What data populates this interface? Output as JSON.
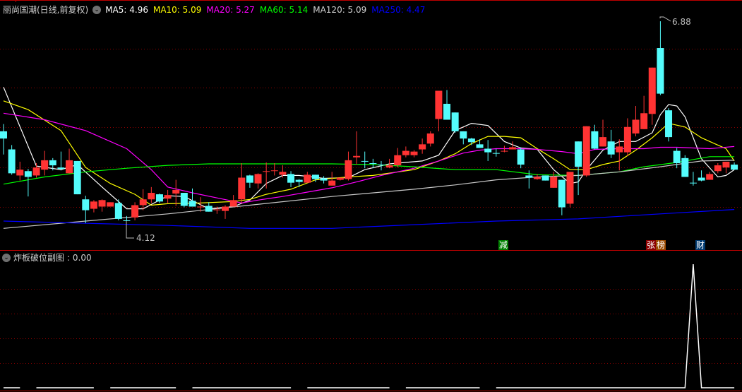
{
  "header": {
    "title": "丽尚国潮(日线,前复权)",
    "ma": [
      {
        "label": "MA5: 4.96",
        "color": "#ffffff"
      },
      {
        "label": "MA10: 5.09",
        "color": "#ffff00"
      },
      {
        "label": "MA20: 5.27",
        "color": "#ff00ff"
      },
      {
        "label": "MA60: 5.14",
        "color": "#00ff00"
      },
      {
        "label": "MA120: 5.09",
        "color": "#d0d0d0"
      },
      {
        "label": "MA250: 4.47",
        "color": "#0000ff"
      }
    ]
  },
  "annotations": {
    "high": "6.88",
    "low": "4.12"
  },
  "event_tags": [
    {
      "label": "减",
      "color": "#008000"
    },
    {
      "label": "张",
      "color": "#8b0000"
    },
    {
      "label": "榜",
      "color": "#9a4a00"
    },
    {
      "label": "财",
      "color": "#003a70"
    }
  ],
  "sub_panel": {
    "title": "炸板破位副图",
    "value": ": 0.00"
  },
  "colors": {
    "up": "#ff3333",
    "down": "#54fcfc",
    "grid": "#8b0000",
    "frame": "#c00000"
  },
  "chart_data": {
    "type": "candlestick",
    "ohlc": [
      [
        5.36,
        5.46,
        5.04,
        5.26
      ],
      [
        5.11,
        5.17,
        4.76,
        4.78
      ],
      [
        4.75,
        4.94,
        4.68,
        4.83
      ],
      [
        4.81,
        4.84,
        4.46,
        4.73
      ],
      [
        4.75,
        4.92,
        4.72,
        4.86
      ],
      [
        4.83,
        5.09,
        4.75,
        4.96
      ],
      [
        4.96,
        4.99,
        4.82,
        4.89
      ],
      [
        4.86,
        5.08,
        4.82,
        4.84
      ],
      [
        4.78,
        5.12,
        4.78,
        4.96
      ],
      [
        4.95,
        4.95,
        4.49,
        4.49
      ],
      [
        4.42,
        4.47,
        4.09,
        4.27
      ],
      [
        4.29,
        4.41,
        4.24,
        4.39
      ],
      [
        4.32,
        4.42,
        4.25,
        4.41
      ],
      [
        4.32,
        4.38,
        4.32,
        4.38
      ],
      [
        4.37,
        4.42,
        4.13,
        4.15
      ],
      [
        4.13,
        4.19,
        4.12,
        4.13
      ],
      [
        4.17,
        4.38,
        4.13,
        4.34
      ],
      [
        4.34,
        4.56,
        4.27,
        4.42
      ],
      [
        4.42,
        4.59,
        4.37,
        4.51
      ],
      [
        4.49,
        4.5,
        4.37,
        4.39
      ],
      [
        4.43,
        4.55,
        4.37,
        4.48
      ],
      [
        4.5,
        4.69,
        4.33,
        4.55
      ],
      [
        4.51,
        4.51,
        4.31,
        4.33
      ],
      [
        4.4,
        4.57,
        4.32,
        4.32
      ],
      [
        4.31,
        4.45,
        4.25,
        4.32
      ],
      [
        4.33,
        4.38,
        4.25,
        4.25
      ],
      [
        4.28,
        4.32,
        4.22,
        4.28
      ],
      [
        4.26,
        4.34,
        4.15,
        4.32
      ],
      [
        4.32,
        4.48,
        4.32,
        4.41
      ],
      [
        4.42,
        4.92,
        4.37,
        4.72
      ],
      [
        4.75,
        4.76,
        4.58,
        4.65
      ],
      [
        4.64,
        4.78,
        4.57,
        4.77
      ],
      [
        4.81,
        4.93,
        4.57,
        4.81
      ],
      [
        4.82,
        4.92,
        4.75,
        4.82
      ],
      [
        4.76,
        4.89,
        4.72,
        4.8
      ],
      [
        4.77,
        4.81,
        4.59,
        4.65
      ],
      [
        4.69,
        4.7,
        4.59,
        4.66
      ],
      [
        4.65,
        4.8,
        4.65,
        4.76
      ],
      [
        4.76,
        4.76,
        4.66,
        4.7
      ],
      [
        4.71,
        4.74,
        4.64,
        4.68
      ],
      [
        4.61,
        4.8,
        4.61,
        4.68
      ],
      [
        4.69,
        4.72,
        4.68,
        4.72
      ],
      [
        4.7,
        5.08,
        4.68,
        4.96
      ],
      [
        5.0,
        5.36,
        4.9,
        5.02
      ],
      [
        4.95,
        5.08,
        4.85,
        4.95
      ],
      [
        4.92,
        4.98,
        4.85,
        4.92
      ],
      [
        4.9,
        4.95,
        4.82,
        4.9
      ],
      [
        4.86,
        4.98,
        4.85,
        4.89
      ],
      [
        4.89,
        5.13,
        4.86,
        5.03
      ],
      [
        5.03,
        5.15,
        5.0,
        5.09
      ],
      [
        5.03,
        5.1,
        5.0,
        5.08
      ],
      [
        5.11,
        5.26,
        5.05,
        5.18
      ],
      [
        5.19,
        5.36,
        5.15,
        5.33
      ],
      [
        5.53,
        5.92,
        5.36,
        5.92
      ],
      [
        5.74,
        5.93,
        5.52,
        5.52
      ],
      [
        5.62,
        5.62,
        5.34,
        5.36
      ],
      [
        5.36,
        5.36,
        5.18,
        5.26
      ],
      [
        5.26,
        5.27,
        5.17,
        5.21
      ],
      [
        5.18,
        5.25,
        5.13,
        5.13
      ],
      [
        5.12,
        5.24,
        4.95,
        5.07
      ],
      [
        5.06,
        5.12,
        5.01,
        5.06
      ],
      [
        5.09,
        5.16,
        5.07,
        5.09
      ],
      [
        5.11,
        5.22,
        5.11,
        5.14
      ],
      [
        5.11,
        5.14,
        4.85,
        4.9
      ],
      [
        4.75,
        4.82,
        4.57,
        4.72
      ],
      [
        4.7,
        4.77,
        4.69,
        4.73
      ],
      [
        4.75,
        4.75,
        4.68,
        4.68
      ],
      [
        4.58,
        4.8,
        4.58,
        4.73
      ],
      [
        4.69,
        4.69,
        4.2,
        4.31
      ],
      [
        4.36,
        4.8,
        4.31,
        4.8
      ],
      [
        5.22,
        5.22,
        4.48,
        4.87
      ],
      [
        4.75,
        5.43,
        4.73,
        5.43
      ],
      [
        5.36,
        5.45,
        5.11,
        5.12
      ],
      [
        5.15,
        5.52,
        5.15,
        5.28
      ],
      [
        5.22,
        5.38,
        4.99,
        5.04
      ],
      [
        5.07,
        5.25,
        4.82,
        5.15
      ],
      [
        5.07,
        5.54,
        5.02,
        5.42
      ],
      [
        5.33,
        5.71,
        5.29,
        5.52
      ],
      [
        5.39,
        5.85,
        5.39,
        5.61
      ],
      [
        5.6,
        6.24,
        5.45,
        6.24
      ],
      [
        6.51,
        6.88,
        5.86,
        5.88
      ],
      [
        5.65,
        5.68,
        5.22,
        5.28
      ],
      [
        5.09,
        5.13,
        4.85,
        4.92
      ],
      [
        4.99,
        5.03,
        4.73,
        4.73
      ],
      [
        4.65,
        4.8,
        4.61,
        4.65
      ],
      [
        4.72,
        4.82,
        4.67,
        4.68
      ],
      [
        4.69,
        4.8,
        4.69,
        4.77
      ],
      [
        4.81,
        4.92,
        4.78,
        4.89
      ],
      [
        4.86,
        4.94,
        4.78,
        4.94
      ],
      [
        4.9,
        4.93,
        4.83,
        4.83
      ]
    ],
    "ma_series": [
      {
        "name": "MA5",
        "color": "#ffffff",
        "points": [
          [
            0,
            5.97
          ],
          [
            4,
            4.88
          ],
          [
            7,
            4.83
          ],
          [
            9,
            4.9
          ],
          [
            12,
            4.59
          ],
          [
            15,
            4.29
          ],
          [
            17,
            4.29
          ],
          [
            20,
            4.47
          ],
          [
            22,
            4.46
          ],
          [
            25,
            4.29
          ],
          [
            28,
            4.32
          ],
          [
            30,
            4.41
          ],
          [
            32,
            4.64
          ],
          [
            34,
            4.75
          ],
          [
            36,
            4.75
          ],
          [
            39,
            4.71
          ],
          [
            42,
            4.72
          ],
          [
            44,
            4.83
          ],
          [
            47,
            4.91
          ],
          [
            51,
            4.95
          ],
          [
            53,
            5.03
          ],
          [
            55,
            5.37
          ],
          [
            57,
            5.47
          ],
          [
            59,
            5.44
          ],
          [
            61,
            5.22
          ],
          [
            63,
            5.13
          ],
          [
            65,
            5.11
          ],
          [
            67,
            4.83
          ],
          [
            69,
            4.64
          ],
          [
            70,
            4.66
          ],
          [
            71,
            4.83
          ],
          [
            73,
            5.1
          ],
          [
            75,
            5.22
          ],
          [
            77,
            5.22
          ],
          [
            79,
            5.34
          ],
          [
            80,
            5.59
          ],
          [
            81,
            5.73
          ],
          [
            82,
            5.71
          ],
          [
            83,
            5.56
          ],
          [
            85,
            4.98
          ],
          [
            87,
            4.73
          ],
          [
            88,
            4.75
          ],
          [
            89,
            4.83
          ]
        ]
      },
      {
        "name": "MA10",
        "color": "#ffff00",
        "points": [
          [
            0,
            5.78
          ],
          [
            3,
            5.66
          ],
          [
            7,
            5.37
          ],
          [
            10,
            4.86
          ],
          [
            13,
            4.64
          ],
          [
            16,
            4.49
          ],
          [
            18,
            4.34
          ],
          [
            20,
            4.36
          ],
          [
            24,
            4.37
          ],
          [
            28,
            4.39
          ],
          [
            30,
            4.42
          ],
          [
            32,
            4.49
          ],
          [
            35,
            4.56
          ],
          [
            38,
            4.69
          ],
          [
            42,
            4.73
          ],
          [
            45,
            4.75
          ],
          [
            50,
            4.83
          ],
          [
            53,
            4.95
          ],
          [
            55,
            5.05
          ],
          [
            57,
            5.19
          ],
          [
            59,
            5.29
          ],
          [
            61,
            5.29
          ],
          [
            63,
            5.27
          ],
          [
            65,
            5.12
          ],
          [
            67,
            4.98
          ],
          [
            69,
            4.83
          ],
          [
            71,
            4.83
          ],
          [
            73,
            4.9
          ],
          [
            75,
            4.95
          ],
          [
            77,
            5.1
          ],
          [
            79,
            5.27
          ],
          [
            81,
            5.47
          ],
          [
            83,
            5.42
          ],
          [
            85,
            5.27
          ],
          [
            87,
            5.17
          ],
          [
            88,
            5.12
          ],
          [
            89,
            4.95
          ]
        ]
      },
      {
        "name": "MA20",
        "color": "#ff00ff",
        "points": [
          [
            0,
            5.61
          ],
          [
            5,
            5.52
          ],
          [
            10,
            5.37
          ],
          [
            15,
            5.12
          ],
          [
            18,
            4.83
          ],
          [
            20,
            4.59
          ],
          [
            23,
            4.51
          ],
          [
            26,
            4.44
          ],
          [
            29,
            4.37
          ],
          [
            31,
            4.41
          ],
          [
            34,
            4.46
          ],
          [
            37,
            4.52
          ],
          [
            40,
            4.58
          ],
          [
            43,
            4.66
          ],
          [
            46,
            4.75
          ],
          [
            50,
            4.85
          ],
          [
            53,
            4.95
          ],
          [
            56,
            5.06
          ],
          [
            58,
            5.1
          ],
          [
            60,
            5.12
          ],
          [
            63,
            5.12
          ],
          [
            65,
            5.11
          ],
          [
            68,
            5.08
          ],
          [
            70,
            5.05
          ],
          [
            72,
            5.11
          ],
          [
            75,
            5.12
          ],
          [
            78,
            5.12
          ],
          [
            80,
            5.14
          ],
          [
            82,
            5.14
          ],
          [
            86,
            5.12
          ],
          [
            89,
            5.15
          ]
        ]
      },
      {
        "name": "MA60",
        "color": "#00ff00",
        "points": [
          [
            0,
            4.63
          ],
          [
            5,
            4.73
          ],
          [
            10,
            4.8
          ],
          [
            15,
            4.85
          ],
          [
            20,
            4.89
          ],
          [
            25,
            4.91
          ],
          [
            30,
            4.91
          ],
          [
            40,
            4.91
          ],
          [
            45,
            4.9
          ],
          [
            50,
            4.87
          ],
          [
            55,
            4.83
          ],
          [
            60,
            4.83
          ],
          [
            65,
            4.76
          ],
          [
            70,
            4.75
          ],
          [
            75,
            4.8
          ],
          [
            78,
            4.87
          ],
          [
            82,
            4.93
          ],
          [
            86,
            5.01
          ],
          [
            89,
            5.01
          ]
        ]
      },
      {
        "name": "MA120",
        "color": "#c8c8c8",
        "points": [
          [
            0,
            4.02
          ],
          [
            10,
            4.12
          ],
          [
            20,
            4.22
          ],
          [
            30,
            4.34
          ],
          [
            40,
            4.46
          ],
          [
            50,
            4.56
          ],
          [
            55,
            4.62
          ],
          [
            60,
            4.69
          ],
          [
            65,
            4.73
          ],
          [
            70,
            4.75
          ],
          [
            75,
            4.8
          ],
          [
            80,
            4.87
          ],
          [
            85,
            4.95
          ],
          [
            89,
            4.96
          ]
        ]
      },
      {
        "name": "MA250",
        "color": "#0000ff",
        "points": [
          [
            0,
            4.12
          ],
          [
            10,
            4.09
          ],
          [
            20,
            4.06
          ],
          [
            30,
            4.02
          ],
          [
            40,
            4.02
          ],
          [
            50,
            4.07
          ],
          [
            60,
            4.12
          ],
          [
            70,
            4.15
          ],
          [
            80,
            4.22
          ],
          [
            89,
            4.28
          ]
        ]
      }
    ],
    "indicator": {
      "name": "炸板破位副图",
      "values": [
        0,
        0,
        0,
        null,
        0,
        0,
        0,
        0,
        0,
        0,
        0,
        0,
        null,
        0,
        0,
        0,
        0,
        0,
        0,
        0,
        0,
        0,
        null,
        0,
        0,
        0,
        0,
        0,
        0,
        0,
        0,
        0,
        0,
        0,
        0,
        0,
        null,
        0,
        0,
        0,
        0,
        0,
        0,
        0,
        0,
        0,
        0,
        0,
        null,
        0,
        0,
        0,
        0,
        0,
        0,
        0,
        0,
        0,
        0,
        null,
        0,
        0,
        0,
        0,
        0,
        0,
        0,
        0,
        0,
        0,
        0,
        0,
        0,
        0,
        0,
        0,
        0,
        0,
        0,
        0,
        0,
        0,
        0,
        0,
        1,
        0,
        0,
        0,
        0,
        0
      ],
      "ylim": [
        0,
        1
      ]
    }
  }
}
